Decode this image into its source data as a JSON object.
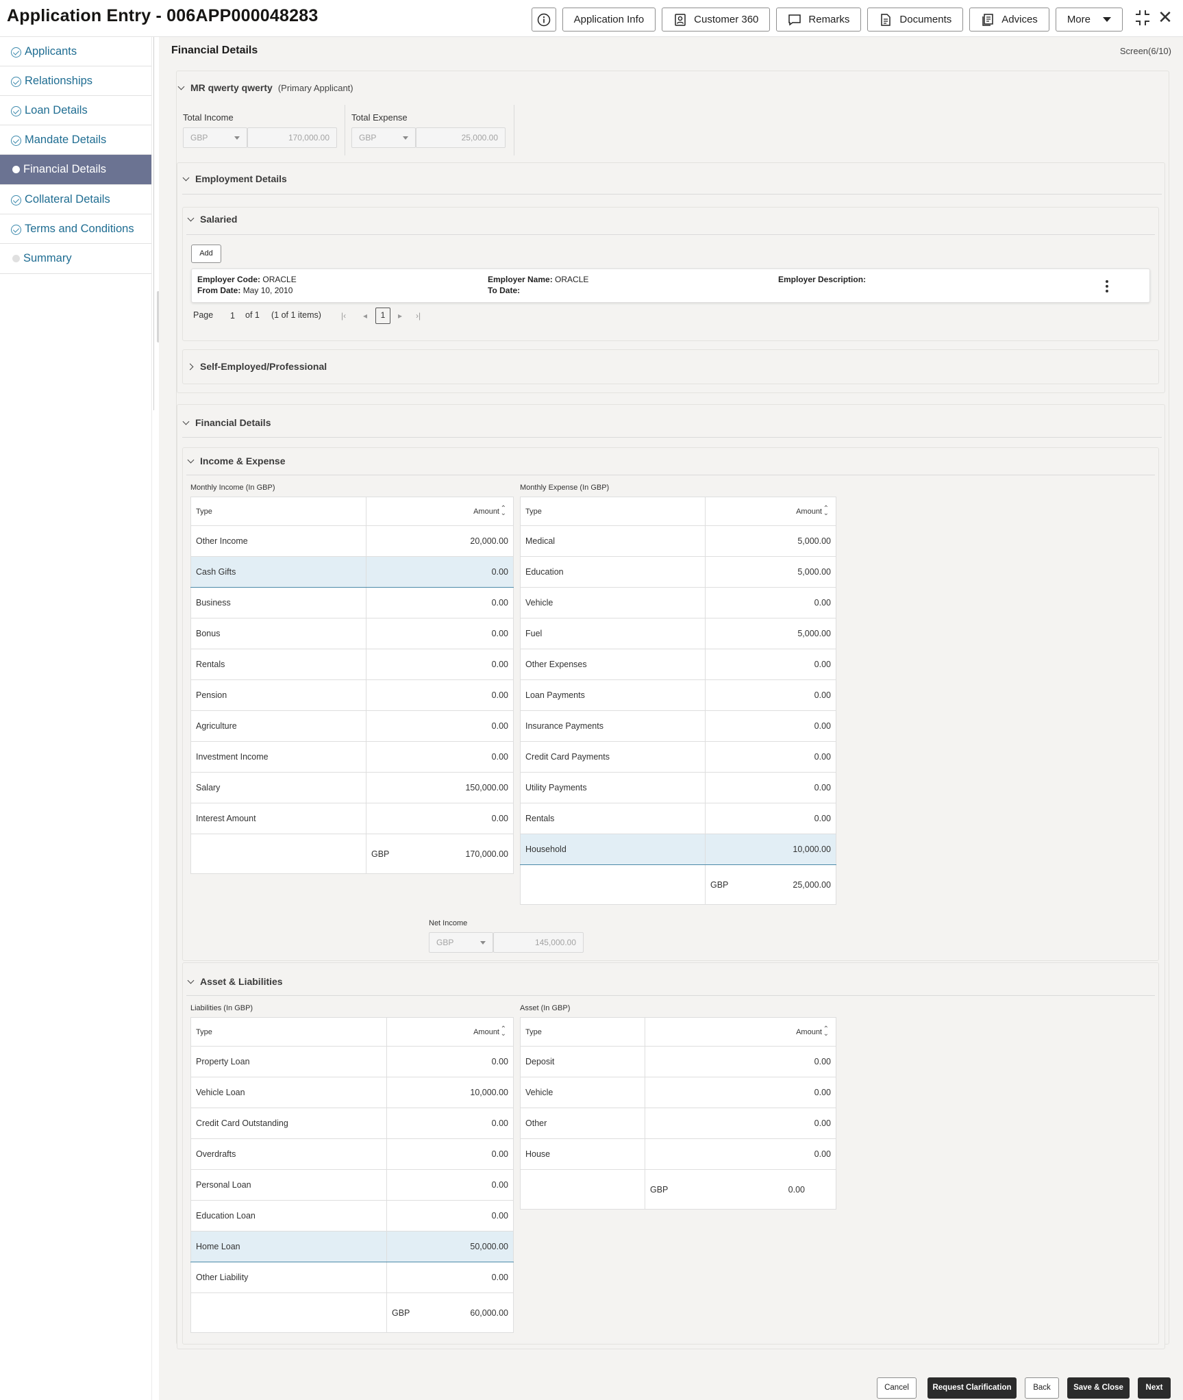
{
  "header": {
    "title": "Application Entry - 006APP000048283",
    "buttons": {
      "info_icon": "info-icon",
      "application_info": "Application Info",
      "customer_360": "Customer 360",
      "remarks": "Remarks",
      "documents": "Documents",
      "advices": "Advices",
      "more": "More"
    },
    "close": "✕"
  },
  "sidebar": {
    "items": [
      {
        "label": "Applicants",
        "state": "done"
      },
      {
        "label": "Relationships",
        "state": "done"
      },
      {
        "label": "Loan Details",
        "state": "done"
      },
      {
        "label": "Mandate Details",
        "state": "done"
      },
      {
        "label": "Financial Details",
        "state": "active"
      },
      {
        "label": "Collateral Details",
        "state": "done"
      },
      {
        "label": "Terms and Conditions",
        "state": "done"
      },
      {
        "label": "Summary",
        "state": "pending"
      }
    ]
  },
  "main": {
    "page_title": "Financial Details",
    "screen": "Screen(6/10)",
    "applicant": {
      "name": "MR qwerty qwerty",
      "role": "(Primary Applicant)",
      "total_income_label": "Total Income",
      "total_income_currency": "GBP",
      "total_income_value": "170,000.00",
      "total_expense_label": "Total Expense",
      "total_expense_currency": "GBP",
      "total_expense_value": "25,000.00"
    },
    "employment": {
      "title": "Employment Details",
      "salaried_title": "Salaried",
      "add_label": "Add",
      "card": {
        "employer_code_label": "Employer Code:",
        "employer_code": "ORACLE",
        "from_date_label": "From Date:",
        "from_date": "May 10, 2010",
        "employer_name_label": "Employer Name:",
        "employer_name": "ORACLE",
        "to_date_label": "To Date:",
        "employer_description_label": "Employer Description:"
      },
      "pager": {
        "page_label": "Page",
        "page": "1",
        "of": "of 1",
        "items": "(1 of 1 items)",
        "current": "1"
      },
      "self_employed_title": "Self-Employed/Professional"
    },
    "financial": {
      "title": "Financial Details",
      "income_expense_title": "Income & Expense",
      "monthly_income_label": "Monthly Income (In GBP)",
      "monthly_expense_label": "Monthly Expense (In GBP)",
      "col_type": "Type",
      "col_amount": "Amount",
      "income_rows": [
        {
          "type": "Other Income",
          "amount": "20,000.00"
        },
        {
          "type": "Cash Gifts",
          "amount": "0.00"
        },
        {
          "type": "Business",
          "amount": "0.00"
        },
        {
          "type": "Bonus",
          "amount": "0.00"
        },
        {
          "type": "Rentals",
          "amount": "0.00"
        },
        {
          "type": "Pension",
          "amount": "0.00"
        },
        {
          "type": "Agriculture",
          "amount": "0.00"
        },
        {
          "type": "Investment Income",
          "amount": "0.00"
        },
        {
          "type": "Salary",
          "amount": "150,000.00"
        },
        {
          "type": "Interest Amount",
          "amount": "0.00"
        }
      ],
      "income_total_currency": "GBP",
      "income_total": "170,000.00",
      "expense_rows": [
        {
          "type": "Medical",
          "amount": "5,000.00"
        },
        {
          "type": "Education",
          "amount": "5,000.00"
        },
        {
          "type": "Vehicle",
          "amount": "0.00"
        },
        {
          "type": "Fuel",
          "amount": "5,000.00"
        },
        {
          "type": "Other Expenses",
          "amount": "0.00"
        },
        {
          "type": "Loan Payments",
          "amount": "0.00"
        },
        {
          "type": "Insurance Payments",
          "amount": "0.00"
        },
        {
          "type": "Credit Card Payments",
          "amount": "0.00"
        },
        {
          "type": "Utility Payments",
          "amount": "0.00"
        },
        {
          "type": "Rentals",
          "amount": "0.00"
        },
        {
          "type": "Household",
          "amount": "10,000.00"
        }
      ],
      "expense_total_currency": "GBP",
      "expense_total": "25,000.00",
      "net_income_label": "Net Income",
      "net_income_currency": "GBP",
      "net_income_value": "145,000.00",
      "asset_liab_title": "Asset & Liabilities",
      "liabilities_label": "Liabilities (In GBP)",
      "asset_label": "Asset (In GBP)",
      "liability_rows": [
        {
          "type": "Property Loan",
          "amount": "0.00"
        },
        {
          "type": "Vehicle Loan",
          "amount": "10,000.00"
        },
        {
          "type": "Credit Card Outstanding",
          "amount": "0.00"
        },
        {
          "type": "Overdrafts",
          "amount": "0.00"
        },
        {
          "type": "Personal Loan",
          "amount": "0.00"
        },
        {
          "type": "Education Loan",
          "amount": "0.00"
        },
        {
          "type": "Home Loan",
          "amount": "50,000.00"
        },
        {
          "type": "Other Liability",
          "amount": "0.00"
        }
      ],
      "liability_total_currency": "GBP",
      "liability_total": "60,000.00",
      "asset_rows": [
        {
          "type": "Deposit",
          "amount": "0.00"
        },
        {
          "type": "Vehicle",
          "amount": "0.00"
        },
        {
          "type": "Other",
          "amount": "0.00"
        },
        {
          "type": "House",
          "amount": "0.00"
        }
      ],
      "asset_total_currency": "GBP",
      "asset_total": "0.00"
    }
  },
  "footer": {
    "cancel": "Cancel",
    "request_clarification": "Request Clarification",
    "back": "Back",
    "save_close": "Save & Close",
    "next": "Next"
  }
}
